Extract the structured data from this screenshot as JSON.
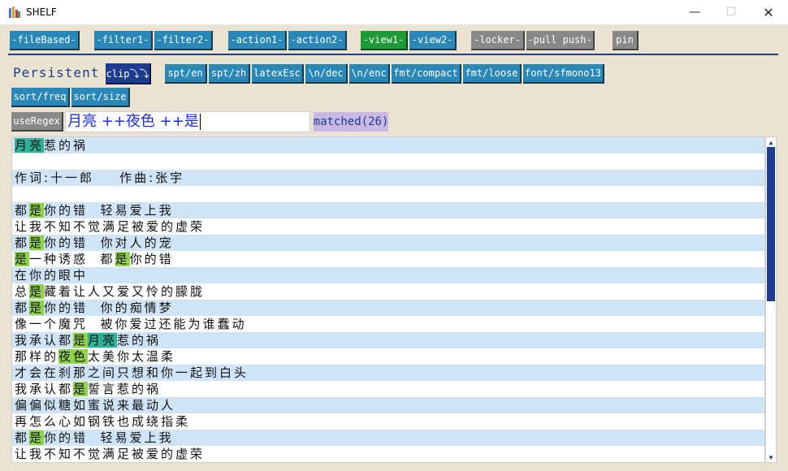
{
  "window": {
    "title": "SHELF",
    "min_glyph": "—",
    "max_glyph": "☐",
    "close_glyph": "✕"
  },
  "toolbar": {
    "file_based": "-fileBased-",
    "filter1": "-filter1-",
    "filter2": "-filter2-",
    "action1": "-action1-",
    "action2": "-action2-",
    "view1": "-view1-",
    "view2": "-view2-",
    "locker": "-locker-",
    "pull_push": "-pull push-",
    "pin": "pin"
  },
  "persistent_label": "Persistent",
  "clip_button": "clip⤵⤵",
  "tools": [
    "spt/en",
    "spt/zh",
    "latexEsc",
    "\\n/dec",
    "\\n/enc",
    "fmt/compact",
    "fmt/loose",
    "font/sfmono13"
  ],
  "sort": {
    "freq": "sort/freq",
    "size": "sort/size"
  },
  "use_regex": "useRegex",
  "search": {
    "value": "月亮 ++夜色 ++是"
  },
  "matched": "matched(26)",
  "lines": [
    [
      [
        "月亮",
        "teal"
      ],
      [
        "惹的祸",
        ""
      ]
    ],
    [],
    [
      [
        "作词:十一郎    作曲:张宇",
        ""
      ]
    ],
    [],
    [
      [
        "都",
        ""
      ],
      [
        "是",
        "green"
      ],
      [
        "你的错  轻易爱上我",
        ""
      ]
    ],
    [
      [
        "让我不知不觉满足被爱的虚荣",
        ""
      ]
    ],
    [
      [
        "都",
        ""
      ],
      [
        "是",
        "green"
      ],
      [
        "你的错  你对人的宠",
        ""
      ]
    ],
    [
      [
        "是",
        "green"
      ],
      [
        "一种诱惑  都",
        ""
      ],
      [
        "是",
        "green"
      ],
      [
        "你的错",
        ""
      ]
    ],
    [
      [
        "在你的眼中",
        ""
      ]
    ],
    [
      [
        "总",
        ""
      ],
      [
        "是",
        "green"
      ],
      [
        "藏着让人又爱又怜的朦胧",
        ""
      ]
    ],
    [
      [
        "都",
        ""
      ],
      [
        "是",
        "green"
      ],
      [
        "你的错  你的痴情梦",
        ""
      ]
    ],
    [
      [
        "像一个魔咒  被你爱过还能为谁蠢动",
        ""
      ]
    ],
    [
      [
        "我承认都",
        ""
      ],
      [
        "是",
        "green"
      ],
      [
        "月亮",
        "teal"
      ],
      [
        "惹的祸",
        ""
      ]
    ],
    [
      [
        "那样的",
        ""
      ],
      [
        "夜色",
        "green"
      ],
      [
        "太美你太温柔",
        ""
      ]
    ],
    [
      [
        "才会在刹那之间只想和你一起到白头",
        ""
      ]
    ],
    [
      [
        "我承认都",
        ""
      ],
      [
        "是",
        "green"
      ],
      [
        "誓言惹的祸",
        ""
      ]
    ],
    [
      [
        "偏偏似糖如蜜说来最动人",
        ""
      ]
    ],
    [
      [
        "再怎么心如钢铁也成绕指柔",
        ""
      ]
    ],
    [
      [
        "都",
        ""
      ],
      [
        "是",
        "green"
      ],
      [
        "你的错  轻易爱上我",
        ""
      ]
    ],
    [
      [
        "让我不知不觉满足被爱的虚荣",
        ""
      ]
    ]
  ],
  "colors": {
    "button_blue": "#2a88b8",
    "button_green": "#1d9a35",
    "button_gray": "#888888",
    "button_navy": "#1e3c8e",
    "highlight_green": "#90d348",
    "highlight_teal": "#2eb398",
    "row_alt": "#cfe5f7",
    "background": "#ebe3d2"
  },
  "icons": {
    "app": "shelf-app-icon",
    "minimize": "minimize-icon",
    "maximize": "maximize-icon",
    "close": "close-icon",
    "scroll_up": "scroll-up-arrow-icon",
    "scroll_down": "scroll-down-arrow-icon"
  }
}
